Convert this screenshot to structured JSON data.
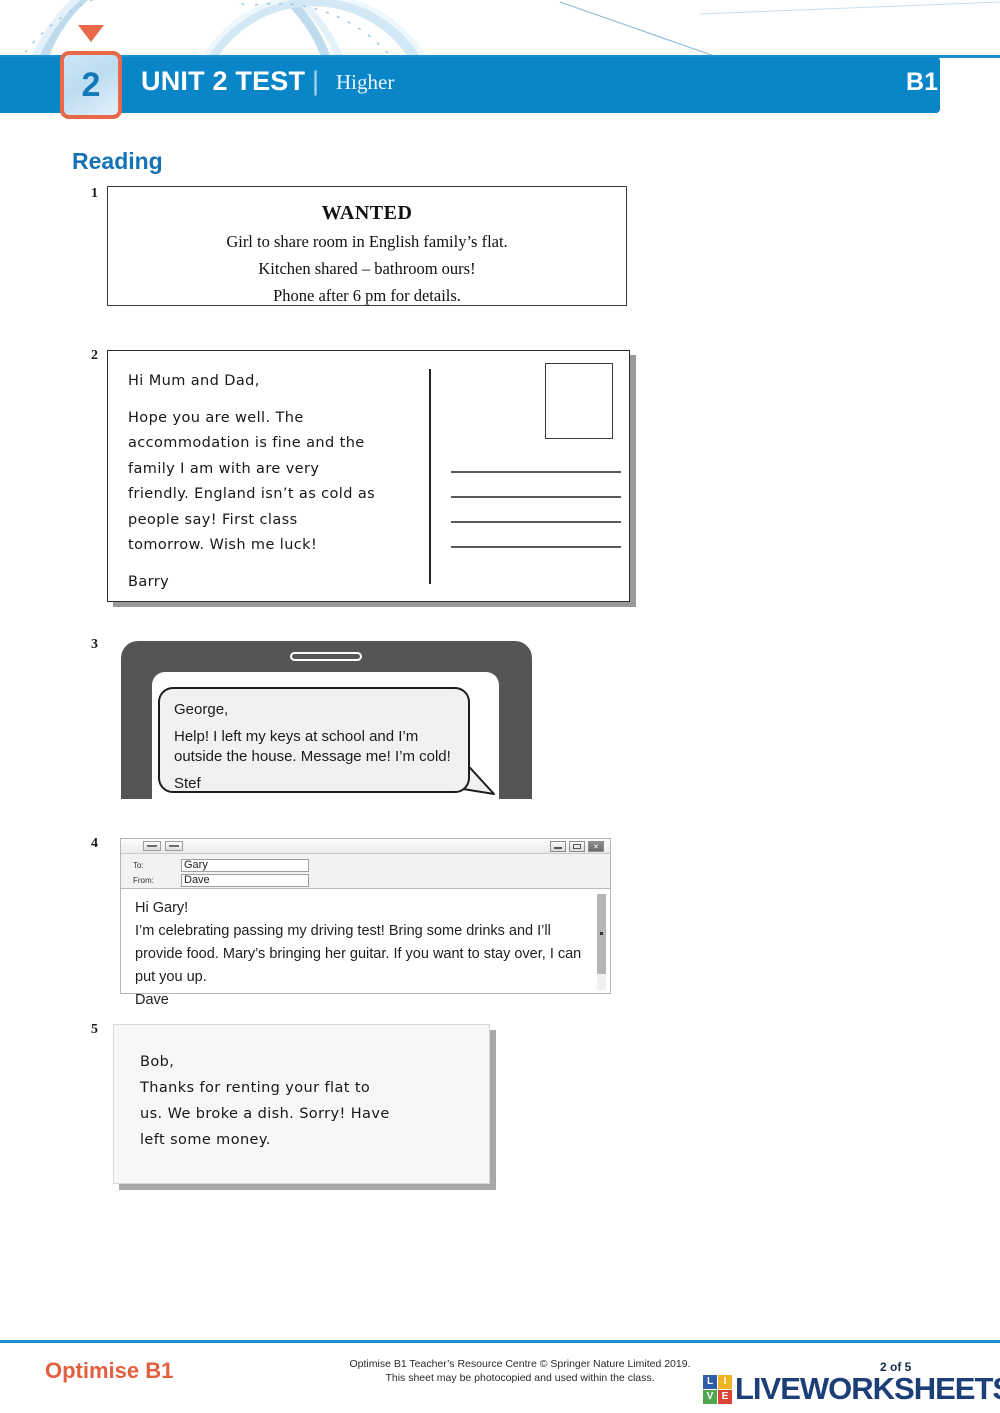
{
  "header": {
    "unit_number": "2",
    "title": "UNIT 2 TEST",
    "divider": "|",
    "level": "Higher",
    "cefr": "B1"
  },
  "section": {
    "title": "Reading"
  },
  "items": [
    {
      "number": "1",
      "type": "advertisement",
      "ad": {
        "title": "WANTED",
        "line1": "Girl to share room in English family’s flat.",
        "line2": "Kitchen shared – bathroom ours!",
        "line3": "Phone after 6 pm for details."
      }
    },
    {
      "number": "2",
      "type": "postcard",
      "postcard": {
        "greeting": "Hi Mum and Dad,",
        "body_line1": "Hope you are well. The",
        "body_line2": "accommodation is fine and the",
        "body_line3": "family I am with are very",
        "body_line4": "friendly. England isn’t as cold as",
        "body_line5": "people say! First class",
        "body_line6": "tomorrow. Wish me luck!",
        "signature": "Barry"
      }
    },
    {
      "number": "3",
      "type": "phone-message",
      "sms": {
        "recipient": "George,",
        "body_line1": "Help! I left my keys at school and I’m",
        "body_line2": "outside the house. Message me! I’m cold!",
        "signature": "Stef"
      }
    },
    {
      "number": "4",
      "type": "email",
      "email": {
        "to_label": "To:",
        "to_value": "Gary",
        "from_label": "From:",
        "from_value": "Dave",
        "greeting": "Hi Gary!",
        "body_line1": "I’m celebrating passing my driving test! Bring some drinks and I’ll",
        "body_line2": "provide food. Mary’s bringing her guitar. If you want to stay over, I can",
        "body_line3": "put you up.",
        "signature": "Dave"
      }
    },
    {
      "number": "5",
      "type": "handwritten-note",
      "note": {
        "greeting": "Bob,",
        "body_line1": "Thanks for renting your flat to",
        "body_line2": "us. We broke a dish. Sorry! Have",
        "body_line3": "left some money."
      }
    }
  ],
  "footer": {
    "brand": "Optimise B1",
    "copyright_line1": "Optimise B1 Teacher’s Resource Centre © Springer Nature Limited 2019.",
    "copyright_line2": "This sheet may be photocopied and used within the class.",
    "page_indicator": "2 of 5",
    "logo_word": "LIVEWORKSHEETS",
    "logo_tiles": [
      {
        "letter": "L",
        "color": "#2d5fa8"
      },
      {
        "letter": "I",
        "color": "#f0b323"
      },
      {
        "letter": "V",
        "color": "#4fa64f"
      },
      {
        "letter": "E",
        "color": "#d94436"
      }
    ]
  },
  "colors": {
    "header_blue": "#0a86c8",
    "accent_orange": "#e8684a",
    "section_blue": "#1573b5",
    "brand_orange": "#e2603f",
    "logo_navy": "#1c3f77"
  }
}
